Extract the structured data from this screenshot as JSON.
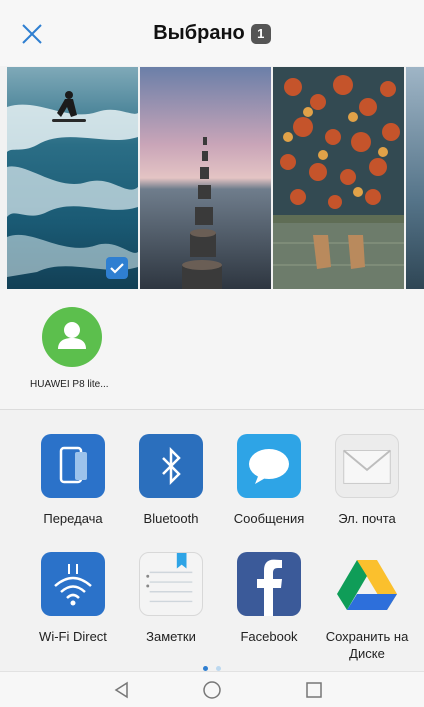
{
  "header": {
    "title": "Выбрано",
    "selected_count": "1",
    "close_icon": "close-icon"
  },
  "photos": [
    {
      "name": "surfer-wave",
      "selected": true
    },
    {
      "name": "sunset-pier",
      "selected": false
    },
    {
      "name": "autumn-leaves",
      "selected": false
    },
    {
      "name": "partial-photo",
      "selected": false
    }
  ],
  "contacts": [
    {
      "name": "HUAWEI P8 lite...",
      "icon": "person-icon",
      "color": "#5cbf4d"
    }
  ],
  "apps": [
    {
      "label": "Передача",
      "icon": "phone-transfer-icon"
    },
    {
      "label": "Bluetooth",
      "icon": "bluetooth-icon"
    },
    {
      "label": "Сообщения",
      "icon": "messages-icon"
    },
    {
      "label": "Эл. почта",
      "icon": "email-icon"
    },
    {
      "label": "Wi-Fi Direct",
      "icon": "wifi-direct-icon"
    },
    {
      "label": "Заметки",
      "icon": "notes-icon"
    },
    {
      "label": "Facebook",
      "icon": "facebook-icon"
    },
    {
      "label": "Сохранить на Диске",
      "icon": "google-drive-icon"
    }
  ],
  "pager": {
    "pages": 2,
    "current": 1
  },
  "colors": {
    "accent_blue": "#2f7fd1",
    "contact_green": "#5cbf4d",
    "title_badge": "#555555"
  },
  "navbar": {
    "back": "back-icon",
    "home": "home-icon",
    "recents": "recents-icon"
  }
}
